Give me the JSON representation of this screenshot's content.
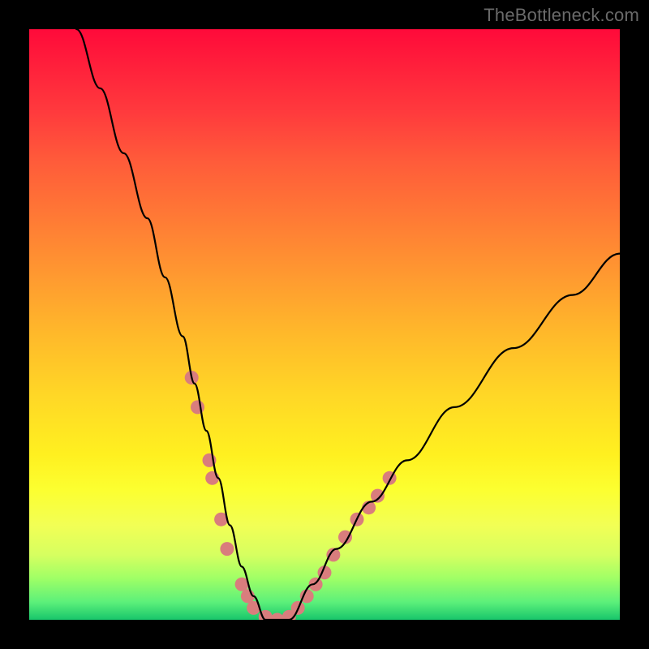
{
  "watermark": "TheBottleneck.com",
  "chart_data": {
    "type": "line",
    "title": "",
    "xlabel": "",
    "ylabel": "",
    "xlim": [
      0,
      100
    ],
    "ylim": [
      0,
      100
    ],
    "grid": false,
    "background_gradient_stops": [
      {
        "pos": 0,
        "color": "#ff0a3a"
      },
      {
        "pos": 14,
        "color": "#ff3a3d"
      },
      {
        "pos": 32,
        "color": "#ff7a35"
      },
      {
        "pos": 52,
        "color": "#ffba2a"
      },
      {
        "pos": 72,
        "color": "#fff020"
      },
      {
        "pos": 84,
        "color": "#f2ff55"
      },
      {
        "pos": 93,
        "color": "#9fff66"
      },
      {
        "pos": 100,
        "color": "#18c56b"
      }
    ],
    "series": [
      {
        "name": "bottleneck-curve",
        "stroke": "#000000",
        "x": [
          8,
          12,
          16,
          20,
          23,
          26,
          28,
          30,
          32,
          34,
          36,
          38,
          40,
          44,
          48,
          52,
          58,
          64,
          72,
          82,
          92,
          100
        ],
        "y": [
          100,
          90,
          79,
          68,
          58,
          48,
          40,
          32,
          24,
          16,
          9,
          4,
          0,
          0,
          6,
          12,
          20,
          27,
          36,
          46,
          55,
          62
        ]
      }
    ],
    "markers": [
      {
        "name": "highlight-beads",
        "color": "#d97d7d",
        "points": [
          {
            "x": 27.5,
            "y": 41
          },
          {
            "x": 28.5,
            "y": 36
          },
          {
            "x": 30.5,
            "y": 27
          },
          {
            "x": 31.0,
            "y": 24
          },
          {
            "x": 32.5,
            "y": 17
          },
          {
            "x": 33.5,
            "y": 12
          },
          {
            "x": 36.0,
            "y": 6
          },
          {
            "x": 37.0,
            "y": 4
          },
          {
            "x": 38.0,
            "y": 2
          },
          {
            "x": 40.0,
            "y": 0.5
          },
          {
            "x": 42.0,
            "y": 0
          },
          {
            "x": 44.0,
            "y": 0.5
          },
          {
            "x": 45.5,
            "y": 2
          },
          {
            "x": 47.0,
            "y": 4
          },
          {
            "x": 48.5,
            "y": 6
          },
          {
            "x": 50.0,
            "y": 8
          },
          {
            "x": 51.5,
            "y": 11
          },
          {
            "x": 53.5,
            "y": 14
          },
          {
            "x": 55.5,
            "y": 17
          },
          {
            "x": 57.5,
            "y": 19
          },
          {
            "x": 59.0,
            "y": 21
          },
          {
            "x": 61.0,
            "y": 24
          }
        ]
      }
    ]
  }
}
